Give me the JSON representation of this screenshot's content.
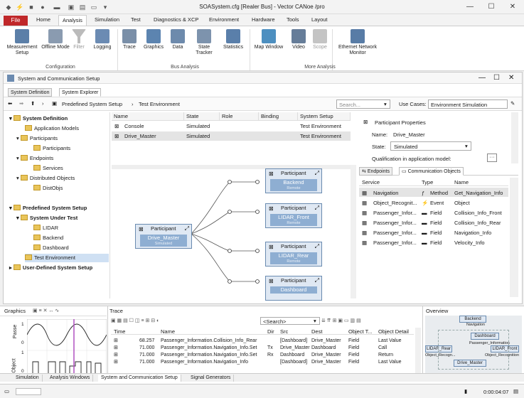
{
  "window": {
    "title": "SOASystem.cfg [Realer Bus] - Vector CANoe /pro"
  },
  "menubar": {
    "file": "File",
    "tabs": [
      "Home",
      "Analysis",
      "Simulation",
      "Test",
      "Diagnostics & XCP",
      "Environment",
      "Hardware",
      "Tools",
      "Layout"
    ]
  },
  "ribbon": {
    "buttons": [
      "Measurement Setup",
      "Offline Mode",
      "Filter",
      "Logging",
      "Trace",
      "Graphics",
      "Data",
      "State Tracker",
      "Statistics",
      "Map Window",
      "Video",
      "Scope",
      "Ethernet Network Monitor"
    ],
    "groups": [
      "Configuration",
      "Bus Analysis",
      "More Analysis"
    ]
  },
  "panel": {
    "title": "System and Communication Setup",
    "subtabs": [
      "System Definition",
      "System Explorer"
    ],
    "breadcrumb": [
      "Predefined System Setup",
      "Test Environment"
    ],
    "search_placeholder": "Search...",
    "use_cases_label": "Use Cases:",
    "use_cases_value": "Environment Simulation"
  },
  "tree": [
    {
      "label": "System Definition",
      "bold": true
    },
    {
      "label": "Application Models"
    },
    {
      "label": "Participants"
    },
    {
      "label": "Participants"
    },
    {
      "label": "Endpoints"
    },
    {
      "label": "Services"
    },
    {
      "label": "Distributed Objects"
    },
    {
      "label": "DistObjs"
    },
    {
      "label": "Predefined System Setup",
      "bold": true
    },
    {
      "label": "System Under Test",
      "bold": true
    },
    {
      "label": "LIDAR"
    },
    {
      "label": "Backend"
    },
    {
      "label": "Dashboard"
    },
    {
      "label": "Test Environment",
      "selected": true
    },
    {
      "label": "User-Defined System Setup",
      "bold": true
    }
  ],
  "table": {
    "headers": [
      "Name",
      "State",
      "Role",
      "Binding",
      "System Setup"
    ],
    "rows": [
      [
        "Console",
        "Simulated",
        "",
        "",
        "Test Environment"
      ],
      [
        "Drive_Master",
        "Simulated",
        "",
        "",
        "Test Environment"
      ]
    ]
  },
  "diagram": {
    "left_node": {
      "title": "Participant",
      "name": "Drive_Master",
      "state": "Simulated"
    },
    "right_nodes": [
      {
        "title": "Participant",
        "name": "Backend",
        "state": "Remote"
      },
      {
        "title": "Participant",
        "name": "LIDAR_Front",
        "state": "Remote"
      },
      {
        "title": "Participant",
        "name": "LIDAR_Rear",
        "state": "Remote"
      },
      {
        "title": "Participant",
        "name": "Dashboard",
        "state": "Remote"
      }
    ]
  },
  "properties": {
    "header": "Participant Properties",
    "name_label": "Name:",
    "name_value": "Drive_Master",
    "state_label": "State:",
    "state_value": "Simulated",
    "qualification_label": "Qualification in application model:",
    "tabs": [
      "Endpoints",
      "Communication Objects"
    ],
    "columns": [
      "Service",
      "Type",
      "Name"
    ],
    "rows": [
      [
        "Navigation",
        "Method",
        "Get_Navigation_Info"
      ],
      [
        "Object_Recognit...",
        "Event",
        "Object"
      ],
      [
        "Passenger_Infor...",
        "Field",
        "Collision_Info_Front"
      ],
      [
        "Passenger_Infor...",
        "Field",
        "Collision_Info_Rear"
      ],
      [
        "Passenger_Infor...",
        "Field",
        "Navigation_Info"
      ],
      [
        "Passenger_Infor...",
        "Field",
        "Velocity_Info"
      ]
    ]
  },
  "graphics": {
    "title": "Graphics",
    "axis_labels": [
      "Object",
      "Passe"
    ],
    "ticks": [
      "1",
      "0",
      "1",
      "0"
    ]
  },
  "trace": {
    "title": "Trace",
    "search_placeholder": "<Search>",
    "columns": [
      "Time",
      "Name",
      "Dir",
      "Src",
      "Dest",
      "Object T...",
      "Object Detail"
    ],
    "rows": [
      [
        "68.257",
        "Passenger_Information.Collision_Info_Rear",
        "",
        "[Dashboard]",
        "Drive_Master",
        "Field",
        "Last Value"
      ],
      [
        "71.000",
        "Passenger_Information.Navigation_Info.Set",
        "Tx",
        "Drive_Master",
        "Dashboard",
        "Field",
        "Call"
      ],
      [
        "71.000",
        "Passenger_Information.Navigation_Info.Set",
        "Rx",
        "Dashboard",
        "Drive_Master",
        "Field",
        "Return"
      ],
      [
        "71.000",
        "Passenger_Information.Navigation_Info",
        "",
        "[Dashboard]",
        "Drive_Master",
        "Field",
        "Last Value"
      ]
    ]
  },
  "overview": {
    "title": "Overview",
    "labels": [
      "Backend",
      "Navigation",
      "Dashboard",
      "LIDAR_Rear",
      "LIDAR_Front",
      "Object_Recogn...",
      "Passenger_Information",
      "Object_Recognition",
      "Drive_Master"
    ]
  },
  "bottom_tabs": [
    "Simulation",
    "Analysis Windows",
    "System and Communication Setup",
    "Signal Generators"
  ],
  "status": {
    "time": "0:00:04:07"
  }
}
